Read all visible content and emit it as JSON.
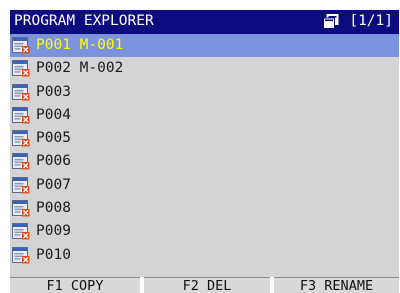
{
  "window": {
    "title": "PROGRAM EXPLORER",
    "pager_icon": "pages-icon",
    "pager": "[1/1]"
  },
  "colors": {
    "title_bg": "#0c0c80",
    "selection_bg": "#7b93dc",
    "selection_text": "#ffff00",
    "panel_bg": "#d4d4d4"
  },
  "programs": [
    {
      "label": "P001 M-001",
      "selected": true
    },
    {
      "label": "P002 M-002",
      "selected": false
    },
    {
      "label": "P003",
      "selected": false
    },
    {
      "label": "P004",
      "selected": false
    },
    {
      "label": "P005",
      "selected": false
    },
    {
      "label": "P006",
      "selected": false
    },
    {
      "label": "P007",
      "selected": false
    },
    {
      "label": "P008",
      "selected": false
    },
    {
      "label": "P009",
      "selected": false
    },
    {
      "label": "P010",
      "selected": false
    }
  ],
  "row_icon": "program-file-icon",
  "function_keys": [
    {
      "label": "F1 COPY"
    },
    {
      "label": "F2 DEL"
    },
    {
      "label": "F3 RENAME"
    }
  ]
}
